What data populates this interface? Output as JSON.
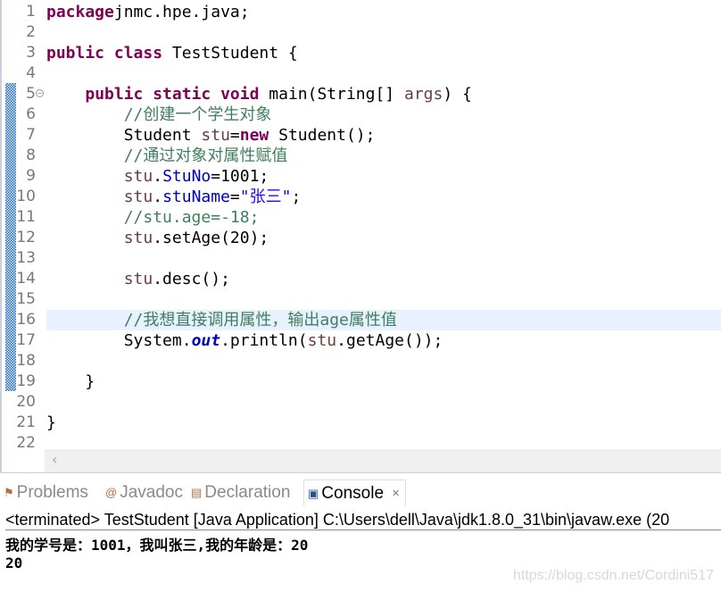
{
  "editor": {
    "highlighted_line": 16,
    "lines": [
      {
        "n": "1",
        "t": [
          [
            "kw",
            "package"
          ],
          [
            "",
            "jnmc.hpe.java;"
          ]
        ]
      },
      {
        "n": "2",
        "t": []
      },
      {
        "n": "3",
        "t": [
          [
            "kw",
            "public class "
          ],
          [
            "",
            "TestStudent {"
          ]
        ]
      },
      {
        "n": "4",
        "t": []
      },
      {
        "n": "5",
        "t": [
          [
            "",
            "    "
          ],
          [
            "kw",
            "public static void "
          ],
          [
            "",
            "main(String[] "
          ],
          [
            "arg",
            "args"
          ],
          [
            "",
            ") {"
          ]
        ]
      },
      {
        "n": "6",
        "t": [
          [
            "cm",
            "        //创建一个学生对象"
          ]
        ]
      },
      {
        "n": "7",
        "t": [
          [
            "",
            "        Student "
          ],
          [
            "arg",
            "stu"
          ],
          [
            "",
            "="
          ],
          [
            "kw",
            "new"
          ],
          [
            "",
            " Student();"
          ]
        ]
      },
      {
        "n": "8",
        "t": [
          [
            "cm",
            "        //通过对象对属性赋值"
          ]
        ]
      },
      {
        "n": "9",
        "t": [
          [
            "arg",
            "        stu"
          ],
          [
            "",
            "."
          ],
          [
            "field",
            "StuNo"
          ],
          [
            "",
            "=1001;"
          ]
        ]
      },
      {
        "n": "10",
        "t": [
          [
            "arg",
            "        stu"
          ],
          [
            "",
            "."
          ],
          [
            "field",
            "stuName"
          ],
          [
            "",
            "="
          ],
          [
            "str",
            "\"张三\""
          ],
          [
            "",
            ";"
          ]
        ]
      },
      {
        "n": "11",
        "t": [
          [
            "cm",
            "        //stu.age=-18;"
          ]
        ]
      },
      {
        "n": "12",
        "t": [
          [
            "arg",
            "        stu"
          ],
          [
            "",
            ".setAge(20);"
          ]
        ]
      },
      {
        "n": "13",
        "t": []
      },
      {
        "n": "14",
        "t": [
          [
            "arg",
            "        stu"
          ],
          [
            "",
            ".desc();"
          ]
        ]
      },
      {
        "n": "15",
        "t": []
      },
      {
        "n": "16",
        "t": [
          [
            "cm",
            "        //我想直接调用属性，输出age属性值"
          ]
        ]
      },
      {
        "n": "17",
        "t": [
          [
            "",
            "        System."
          ],
          [
            "st",
            "out"
          ],
          [
            "",
            ".println("
          ],
          [
            "arg",
            "stu"
          ],
          [
            "",
            ".getAge());"
          ]
        ]
      },
      {
        "n": "18",
        "t": []
      },
      {
        "n": "19",
        "t": [
          [
            "",
            "    }"
          ]
        ]
      },
      {
        "n": "20",
        "t": []
      },
      {
        "n": "21",
        "t": [
          [
            "",
            "}"
          ]
        ]
      },
      {
        "n": "22",
        "t": []
      }
    ],
    "scroll_left": "‹"
  },
  "console": {
    "tabs": [
      {
        "label": "Problems",
        "icon": "problems-icon",
        "active": false
      },
      {
        "label": "Javadoc",
        "icon": "at-icon",
        "active": false
      },
      {
        "label": "Declaration",
        "icon": "declaration-icon",
        "active": false
      },
      {
        "label": "Console",
        "icon": "console-icon",
        "active": true
      }
    ],
    "close": "✕",
    "status": "<terminated> TestStudent [Java Application] C:\\Users\\dell\\Java\\jdk1.8.0_31\\bin\\javaw.exe (20",
    "output": [
      "我的学号是：1001，我叫张三,我的年龄是：20",
      "20"
    ]
  },
  "watermark": "https://blog.csdn.net/Cordini517"
}
